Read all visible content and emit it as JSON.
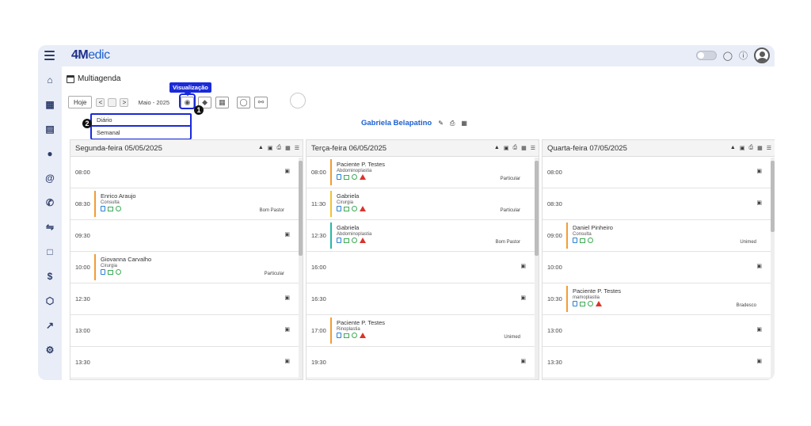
{
  "app": {
    "logo_main": "4M",
    "logo_rest": "edic"
  },
  "page": {
    "title": "Multiagenda"
  },
  "toolbar": {
    "today_label": "Hoje",
    "prev": "<",
    "next": ">",
    "month_label": "Maio - 2025",
    "tooltip": "Visualização"
  },
  "dropdown": {
    "options": [
      "Diário",
      "Semanal"
    ]
  },
  "badges": [
    "1",
    "2"
  ],
  "doctor": {
    "name": "Gabriela Belapatino"
  },
  "days": [
    {
      "title": "Segunda-feira 05/05/2025",
      "rows": [
        {
          "time": "08:00"
        },
        {
          "time": "08:30",
          "name": "Enrico Araujo",
          "type": "Consulta",
          "ins": "Bom Pastor",
          "color": "orange"
        },
        {
          "time": "09:30"
        },
        {
          "time": "10:00",
          "name": "Giovanna Carvalho",
          "type": "Cirurgia",
          "ins": "Particular",
          "color": "orange"
        },
        {
          "time": "12:30"
        },
        {
          "time": "13:00"
        },
        {
          "time": "13:30"
        }
      ]
    },
    {
      "title": "Terça-feira 06/05/2025",
      "rows": [
        {
          "time": "08:00",
          "name": "Paciente P. Testes",
          "type": "Abdominoplastia",
          "ins": "Particular",
          "color": "orange",
          "warn": true
        },
        {
          "time": "11:30",
          "name": "Gabriela",
          "type": "Cirurgia",
          "ins": "Particular",
          "color": "yellow",
          "warn": true
        },
        {
          "time": "12:30",
          "name": "Gabriela",
          "type": "Abdominoplastia",
          "ins": "Bom Pastor",
          "color": "teal",
          "warn": true
        },
        {
          "time": "16:00"
        },
        {
          "time": "16:30"
        },
        {
          "time": "17:00",
          "name": "Paciente P. Testes",
          "type": "Rinoplastia",
          "ins": "Unimed",
          "color": "orange",
          "warn": true
        },
        {
          "time": "19:30"
        }
      ]
    },
    {
      "title": "Quarta-feira 07/05/2025",
      "rows": [
        {
          "time": "08:00"
        },
        {
          "time": "08:30"
        },
        {
          "time": "09:00",
          "name": "Daniel Pinheiro",
          "type": "Consulta",
          "ins": "Unimed",
          "color": "orange"
        },
        {
          "time": "10:00"
        },
        {
          "time": "10:30",
          "name": "Paciente P. Testes",
          "type": "mamoplastia",
          "ins": "Bradesco",
          "color": "orange",
          "warn": true
        },
        {
          "time": "13:00"
        },
        {
          "time": "13:30"
        }
      ]
    }
  ],
  "colors": {
    "accent": "#1a2ad9",
    "brand": "#1d5fd0",
    "orange": "#f39c34",
    "yellow": "#f2c230",
    "teal": "#27b7a7"
  }
}
